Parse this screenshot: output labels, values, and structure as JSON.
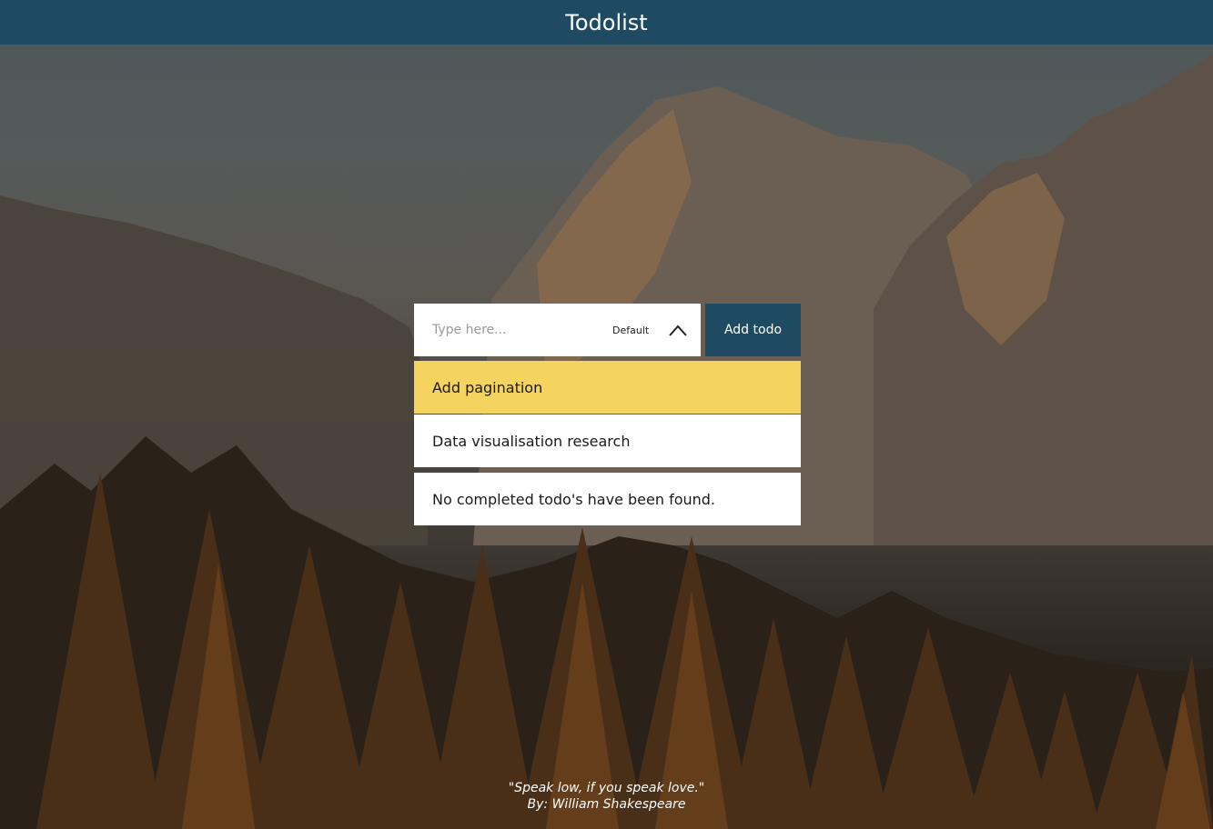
{
  "app": {
    "title": "Todolist"
  },
  "form": {
    "input_placeholder": "Type here...",
    "priority_value": "Default",
    "add_button_label": "Add todo"
  },
  "todos": [
    {
      "text": "Add pagination",
      "color": "#f4d35e"
    },
    {
      "text": "Data visualisation research",
      "color": "#ffffff"
    }
  ],
  "completed": {
    "empty_message": "No completed todo's have been found."
  },
  "quote": {
    "text": "\"Speak low, if you speak love.\"",
    "author": "By: William Shakespeare"
  },
  "colors": {
    "header": "#1f4b62",
    "accent": "#1f4b62",
    "highlight": "#f4d35e"
  },
  "icons": {
    "priority_toggle": "chevron-up-icon"
  }
}
